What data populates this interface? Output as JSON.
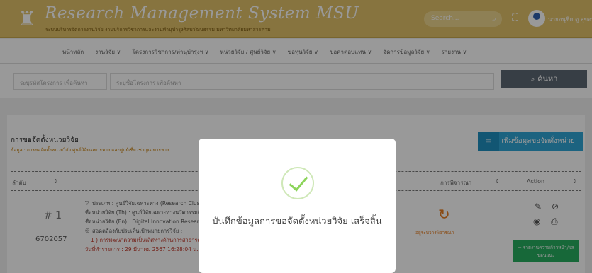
{
  "header": {
    "title": "Research Management System MSU",
    "subtitle": "ระบบบริหารจัดการงานวิจัย งานบริการวิชาการและงานทำนุบำรุงศิลปวัฒนธรรม มหาวิทยาลัยมหาสารคาม",
    "search_placeholder": "Search...",
    "user_name": "นายอนุชิต ดู สุขอนันต์"
  },
  "nav": [
    "หน้าหลัก",
    "งานวิจัย ∨",
    "โครงการวิชาการ/ทำนุบำรุงฯ ∨",
    "หน่วยวิจัย / ศูนย์วิจัย ∨",
    "ขอทุนวิจัย ∨",
    "ขอค่าตอบแทน ∨",
    "จัดการข้อมูลวิจัย ∨",
    "รายงาน ∨"
  ],
  "filter": {
    "code_placeholder": "ระบุรหัสโครงการ เพื่อค้นหา",
    "name_placeholder": "ระบุชื่อโครงการ เพื่อค้นหา",
    "search_button": "ค้นหา"
  },
  "card": {
    "title": "การขอจัดตั้งหน่วยวิจัย",
    "subtitle": "ข้อมูล : การขอจัดตั้งหน่วยวิจัย ศูนย์วิจัยเฉพาะทาง และศูนย์เชี่ยวชาญเฉพาะทาง",
    "add_button": "เพิ่มข้อมูลขอจัดตั้งหน่วยวิจัย",
    "columns": [
      "ลำดับ",
      "การพิจารณา",
      "Action"
    ]
  },
  "row": {
    "seq": "# 1",
    "code": "6702057",
    "type_line": "ประเภท : ศูนย์วิจัยเฉพาะทาง (Research Cluster",
    "name_th": "ชื่อหน่วยวิจัย (Th) : ศูนย์วิจัยเฉพาะทางนวัตกรรมดิจิ",
    "name_en": "ชื่อหน่วยวิจัย (En) : Digital Innovation Research",
    "consistency": "สอดคล้องกับประเด็นเป้าหมายการวิจัย :",
    "issue": "1 ) การพัฒนาความเป็นเลิศทางด้านการสาธารณ ด้านการเกษตร ด้านปศุสัตว์ และด้านพลอยใหม่",
    "date": "วันที่ทำรายการ : 29 มีนาคม 2567 16:28:04 น.",
    "status": "อยู่ระหว่างพิจารณา",
    "green_button": "= รายงานความก้าวหน้า/ผล ขอนแนะ"
  },
  "modal": {
    "message": "บันทึกข้อมูลการขอจัดตั้งหน่วยวิจัย เสร็จสิ้น"
  }
}
